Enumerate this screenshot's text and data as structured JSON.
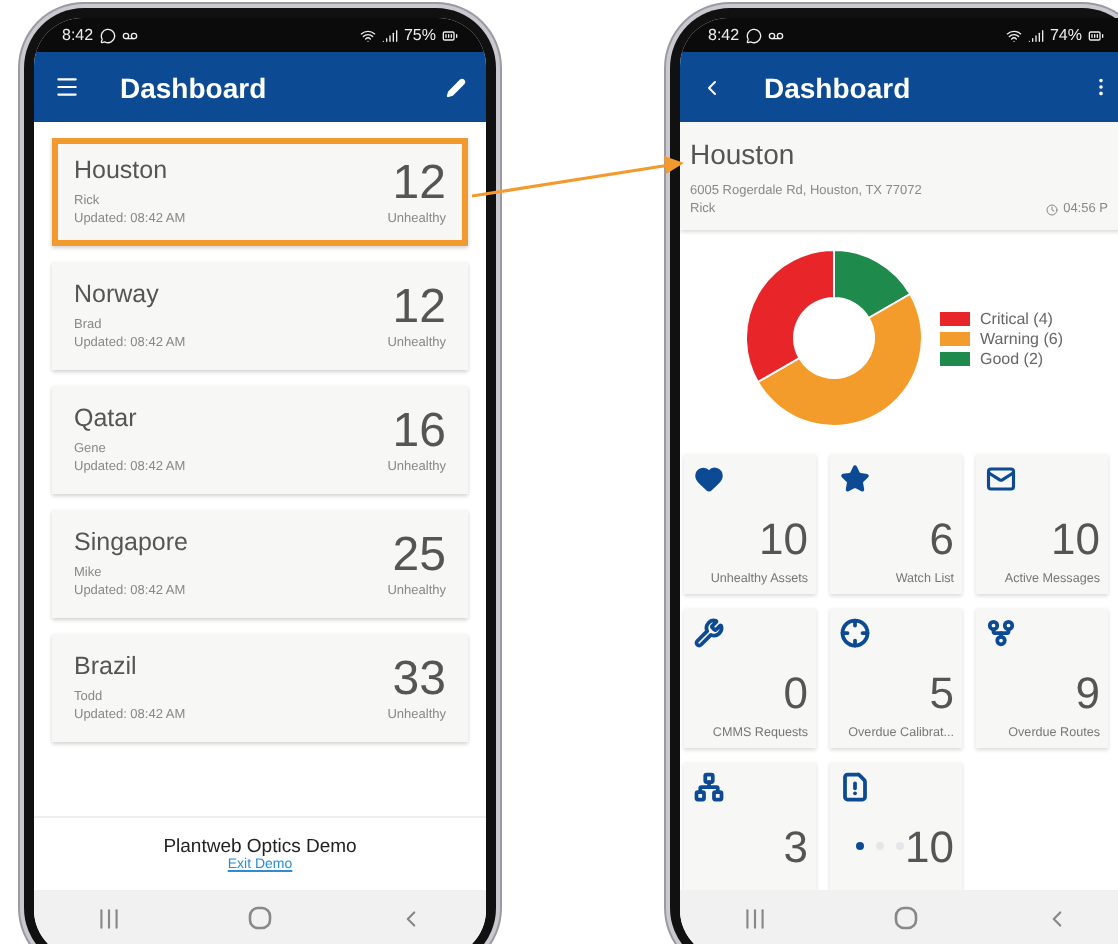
{
  "left_phone": {
    "status_bar": {
      "time": "8:42",
      "battery": "75%"
    },
    "app_bar": {
      "title": "Dashboard"
    },
    "sites": [
      {
        "name": "Houston",
        "person": "Rick",
        "updated": "Updated: 08:42 AM",
        "count": "12",
        "count_label": "Unhealthy",
        "highlighted": true
      },
      {
        "name": "Norway",
        "person": "Brad",
        "updated": "Updated: 08:42 AM",
        "count": "12",
        "count_label": "Unhealthy",
        "highlighted": false
      },
      {
        "name": "Qatar",
        "person": "Gene",
        "updated": "Updated: 08:42 AM",
        "count": "16",
        "count_label": "Unhealthy",
        "highlighted": false
      },
      {
        "name": "Singapore",
        "person": "Mike",
        "updated": "Updated: 08:42 AM",
        "count": "25",
        "count_label": "Unhealthy",
        "highlighted": false
      },
      {
        "name": "Brazil",
        "person": "Todd",
        "updated": "Updated: 08:42 AM",
        "count": "33",
        "count_label": "Unhealthy",
        "highlighted": false
      }
    ],
    "footer": {
      "title": "Plantweb Optics Demo",
      "link": "Exit Demo"
    }
  },
  "right_phone": {
    "status_bar": {
      "time": "8:42",
      "battery": "74%"
    },
    "app_bar": {
      "title": "Dashboard"
    },
    "site": {
      "name": "Houston",
      "address": "6005 Rogerdale Rd, Houston, TX 77072",
      "person": "Rick",
      "time": "04:56 P"
    },
    "chart_data": {
      "type": "donut",
      "categories": [
        "Critical (4)",
        "Warning (6)",
        "Good (2)"
      ],
      "values": [
        4,
        6,
        2
      ],
      "colors": [
        "#e8262a",
        "#f39c2c",
        "#1e8a4c"
      ]
    },
    "tiles": [
      {
        "count": "10",
        "label": "Unhealthy Assets"
      },
      {
        "count": "6",
        "label": "Watch List"
      },
      {
        "count": "10",
        "label": "Active Messages"
      },
      {
        "count": "0",
        "label": "CMMS Requests"
      },
      {
        "count": "5",
        "label": "Overdue Calibrat..."
      },
      {
        "count": "9",
        "label": "Overdue Routes"
      },
      {
        "count": "3"
      },
      {
        "count": "10"
      }
    ],
    "page_dots": [
      {
        "selected": true
      },
      {
        "selected": false
      },
      {
        "selected": false
      }
    ]
  }
}
